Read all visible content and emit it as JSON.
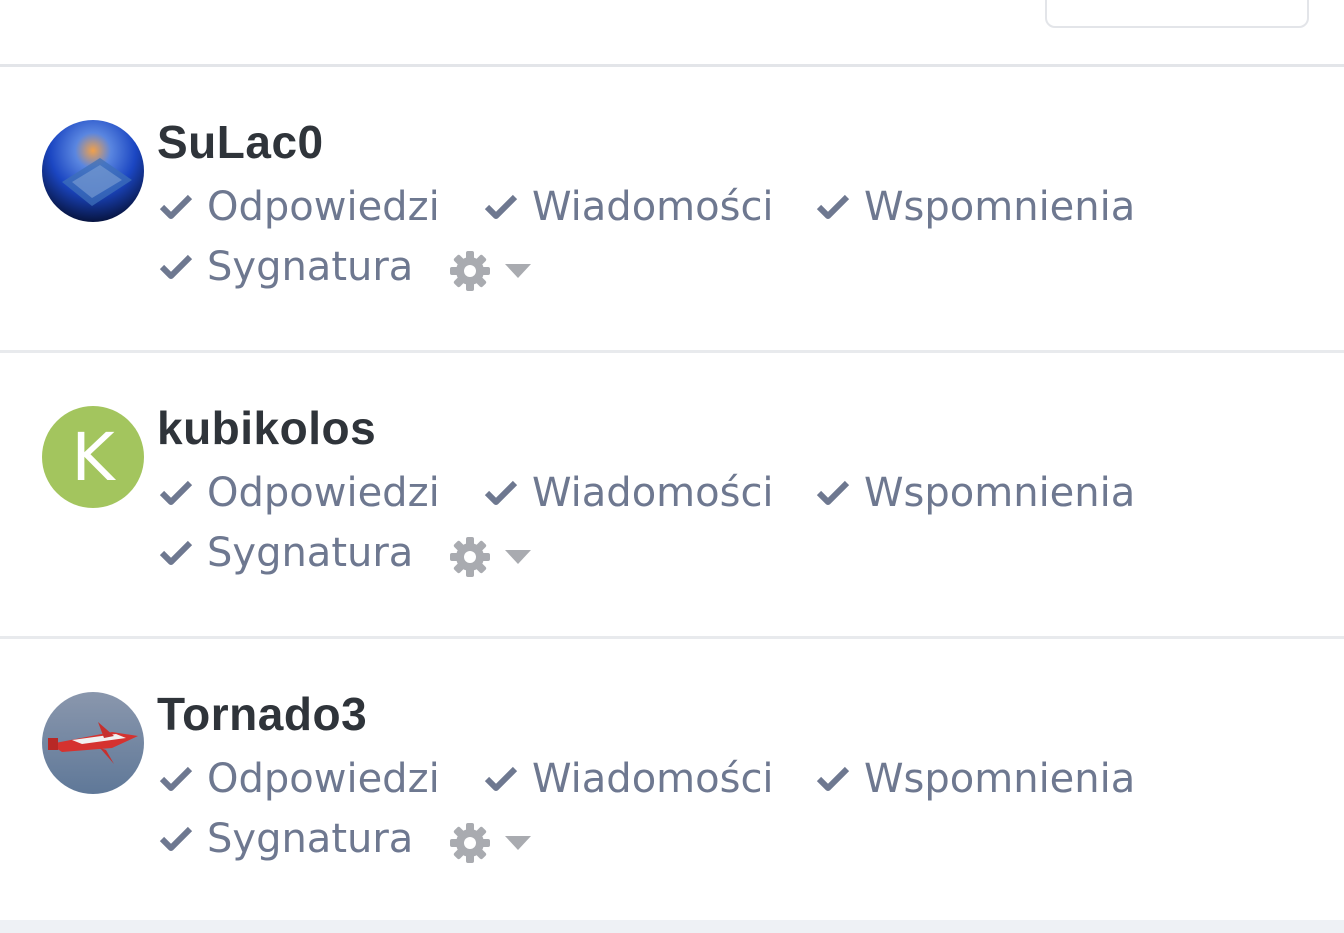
{
  "users": [
    {
      "username": "SuLac0",
      "avatar": "photo-blue-flame-chip",
      "options": [
        {
          "label": "Odpowiedzi",
          "checked": true
        },
        {
          "label": "Wiadomości",
          "checked": true
        },
        {
          "label": "Wspomnienia",
          "checked": true
        },
        {
          "label": "Sygnatura",
          "checked": true
        }
      ]
    },
    {
      "username": "kubikolos",
      "avatar_letter": "K",
      "avatar_color": "#a3c55e",
      "options": [
        {
          "label": "Odpowiedzi",
          "checked": true
        },
        {
          "label": "Wiadomości",
          "checked": true
        },
        {
          "label": "Wspomnienia",
          "checked": true
        },
        {
          "label": "Sygnatura",
          "checked": true
        }
      ]
    },
    {
      "username": "Tornado3",
      "avatar": "photo-red-airplane",
      "options": [
        {
          "label": "Odpowiedzi",
          "checked": true
        },
        {
          "label": "Wiadomości",
          "checked": true
        },
        {
          "label": "Wspomnienia",
          "checked": true
        },
        {
          "label": "Sygnatura",
          "checked": true
        }
      ]
    }
  ],
  "icons": {
    "check": "check-icon",
    "settings": "gear-icon",
    "dropdown": "caret-down-icon"
  },
  "colors": {
    "username": "#2f343a",
    "option_text": "#6e7890",
    "gear": "#a9abb0",
    "divider": "#e8eaed"
  }
}
